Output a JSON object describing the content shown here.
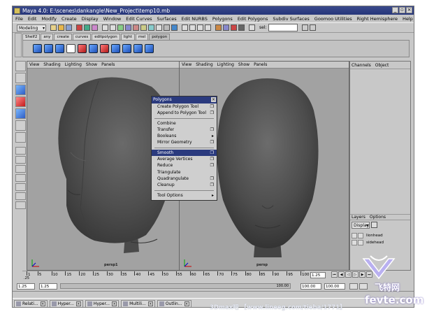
{
  "window": {
    "title": "Maya 4.0: E:\\scenes\\dankangle\\New_Project\\temp10.mb",
    "buttons": [
      "_",
      "▫",
      "×"
    ]
  },
  "menubar": [
    "File",
    "Edit",
    "Modify",
    "Create",
    "Display",
    "Window",
    "Edit Curves",
    "Surfaces",
    "Edit NURBS",
    "Polygons",
    "Edit Polygons",
    "Subdiv Surfaces",
    "Goomoo Utilities",
    "Right Hemisphere",
    "Help"
  ],
  "statusline": {
    "mode": "Modeling",
    "sel_label": "sel:"
  },
  "shelf_tabs": [
    "Shelf2",
    "any",
    "create",
    "curves",
    "editpolygon",
    "light",
    "mel",
    "polygon"
  ],
  "left_panel": {
    "menus": [
      "View",
      "Shading",
      "Lighting",
      "Show",
      "Panels"
    ],
    "camera": "persp1"
  },
  "right_panel": {
    "menus": [
      "View",
      "Shading",
      "Lighting",
      "Show",
      "Panels"
    ],
    "camera": "persp"
  },
  "channel_box": {
    "menus": [
      "Channels",
      "Object"
    ]
  },
  "layers": {
    "menus": [
      "Layers",
      "Options"
    ],
    "display": "Display",
    "items": [
      "lionhead",
      "sidehead"
    ]
  },
  "polygons_menu": {
    "title": "Polygons",
    "close": "×",
    "items": [
      {
        "label": "Create Polygon Tool",
        "mark": "❐"
      },
      {
        "label": "Append to Polygon Tool",
        "mark": "❐"
      },
      {
        "sep": true
      },
      {
        "label": "Combine",
        "mark": ""
      },
      {
        "label": "Transfer",
        "mark": "❐"
      },
      {
        "label": "Booleans",
        "mark": "▸"
      },
      {
        "label": "Mirror Geometry",
        "mark": "❐"
      },
      {
        "sep": true
      },
      {
        "label": "Smooth",
        "mark": "❐",
        "highlight": true
      },
      {
        "label": "Average Vertices",
        "mark": "❐"
      },
      {
        "label": "Reduce",
        "mark": "❐"
      },
      {
        "label": "Triangulate",
        "mark": ""
      },
      {
        "label": "Quadrangulate",
        "mark": "❐"
      },
      {
        "label": "Cleanup",
        "mark": "❐"
      },
      {
        "sep": true
      },
      {
        "label": "Tool Options",
        "mark": "▸"
      }
    ]
  },
  "timeline": {
    "ticks": [
      "1",
      "5",
      "10",
      "15",
      "20",
      "25",
      "30",
      "35",
      "40",
      "45",
      "50",
      "55",
      "60",
      "65",
      "70",
      "75",
      "80",
      "85",
      "90",
      "95",
      "100"
    ],
    "current": "1.25",
    "start_label": "1.25",
    "range_start": "1.25",
    "range_start2": "1.25",
    "range_end": "100.00",
    "range_end2": "100.00",
    "end_value": "100.00",
    "small_value": ".25"
  },
  "taskbar": [
    {
      "label": "Relati..."
    },
    {
      "label": "Hyper..."
    },
    {
      "label": "Hyper..."
    },
    {
      "label": "Multili..."
    },
    {
      "label": "Outlin..."
    }
  ],
  "watermark": {
    "text": "3Dmax吧 【www.lineeg.com/tieba/1771】",
    "brand1": "飞特网",
    "brand2": "fevte.com"
  }
}
